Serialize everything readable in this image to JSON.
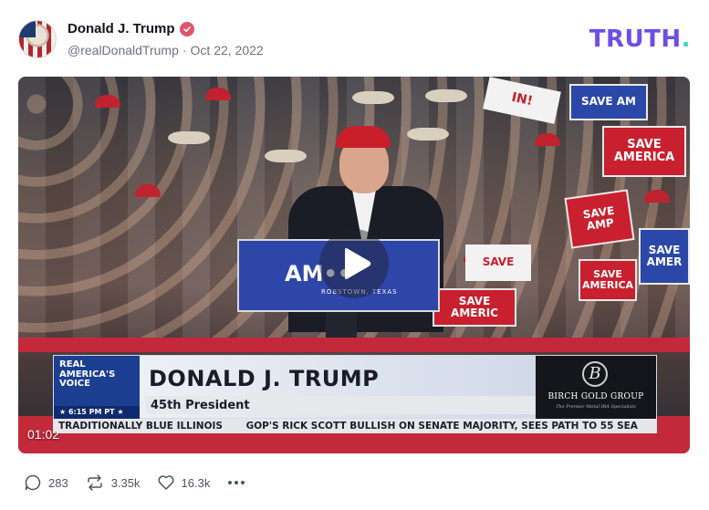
{
  "post": {
    "author_name": "Donald J. Trump",
    "handle": "@realDonaldTrump",
    "separator": "·",
    "date": "Oct 22, 2022",
    "verified_icon": "verified-badge-icon",
    "brand_logo": "TRUTH",
    "brand_logo_dot": ".",
    "colors": {
      "brand": "#6c4ee8",
      "brand_dot": "#3ed5c4",
      "verified": "#e0556b"
    }
  },
  "video": {
    "duration": "01:02",
    "podium_text": "AM••",
    "podium_subtext": "ROBSTOWN, TEXAS",
    "signs": [
      "SAVE AMERICA!",
      "SAVE AMERICA",
      "SAVE AMERICA",
      "SAVE AMER",
      "SAVE AMERIC",
      "SAVE AMP",
      "SAVE AMERICA",
      "SAVE",
      "IN!",
      "SAVE AM"
    ],
    "lower_third": {
      "network_line1": "REAL",
      "network_line2": "AMERICA'S",
      "network_line3": "VOICE",
      "time": "★ 6:15 PM PT ★",
      "name": "DONALD J. TRUMP",
      "title": "45th President",
      "sponsor_mark": "B",
      "sponsor_name": "BIRCH GOLD GROUP",
      "sponsor_tagline": "The Premier Metal IRA Specialists"
    },
    "ticker": [
      "TRADITIONALLY BLUE ILLINOIS",
      "GOP'S RICK SCOTT BULLISH ON SENATE MAJORITY, SEES PATH TO 55 SEA"
    ]
  },
  "actions": {
    "replies": "283",
    "retruths": "3.35k",
    "likes": "16.3k"
  }
}
